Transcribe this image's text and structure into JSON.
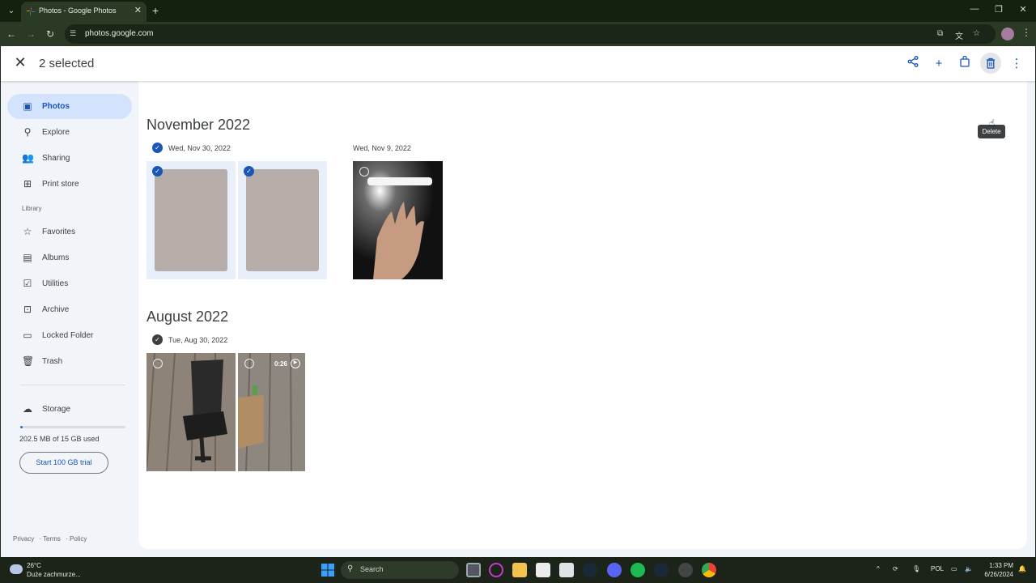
{
  "browser": {
    "tab_title": "Photos - Google Photos",
    "url": "photos.google.com"
  },
  "header": {
    "selected_label": "2 selected",
    "tooltip": "Delete"
  },
  "sidebar": {
    "items": [
      {
        "label": "Photos"
      },
      {
        "label": "Explore"
      },
      {
        "label": "Sharing"
      },
      {
        "label": "Print store"
      }
    ],
    "library_heading": "Library",
    "library_items": [
      {
        "label": "Favorites"
      },
      {
        "label": "Albums"
      },
      {
        "label": "Utilities"
      },
      {
        "label": "Archive"
      },
      {
        "label": "Locked Folder"
      },
      {
        "label": "Trash"
      }
    ],
    "storage_label": "Storage",
    "storage_used": "202.5 MB of 15 GB used",
    "storage_fraction": 0.013,
    "trial_button": "Start 100 GB trial",
    "footer": [
      "Privacy",
      "Terms",
      "Policy"
    ]
  },
  "main": {
    "sections": [
      {
        "month": "November 2022",
        "days": [
          {
            "date": "Wed, Nov 30, 2022",
            "selected": true
          },
          {
            "date": "Wed, Nov 9, 2022",
            "selected": false
          }
        ]
      },
      {
        "month": "August 2022",
        "days": [
          {
            "date": "Tue, Aug 30, 2022",
            "selected": false
          }
        ]
      }
    ],
    "video_duration": "0:26"
  },
  "taskbar": {
    "temperature": "26°C",
    "weather": "Duże zachmurze...",
    "search_label": "Search",
    "language": "POL",
    "time": "1:33 PM",
    "date": "6/26/2024"
  },
  "colors": {
    "accent": "#1a56b8",
    "selected_nav": "#d3e3fd"
  }
}
